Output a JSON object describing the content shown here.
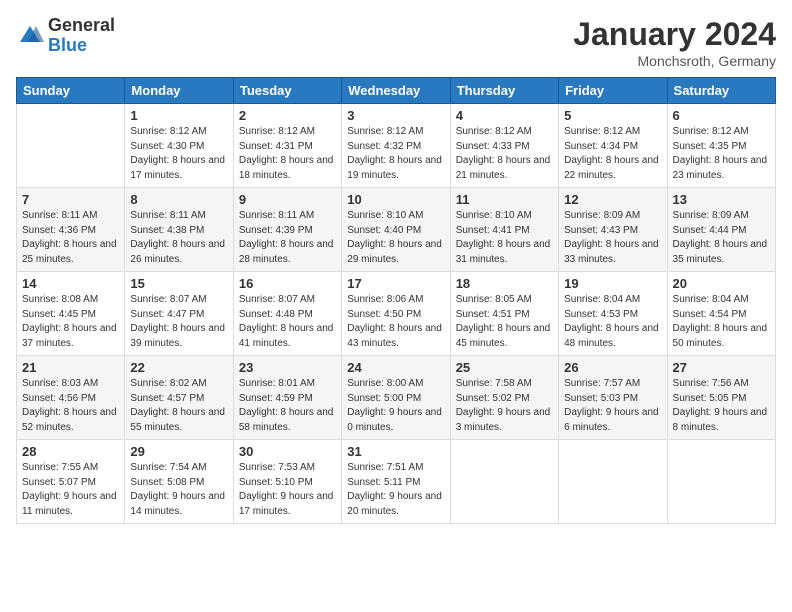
{
  "header": {
    "logo_general": "General",
    "logo_blue": "Blue",
    "title": "January 2024",
    "location": "Monchsroth, Germany"
  },
  "weekdays": [
    "Sunday",
    "Monday",
    "Tuesday",
    "Wednesday",
    "Thursday",
    "Friday",
    "Saturday"
  ],
  "weeks": [
    [
      {
        "day": "",
        "sunrise": "",
        "sunset": "",
        "daylight": ""
      },
      {
        "day": "1",
        "sunrise": "Sunrise: 8:12 AM",
        "sunset": "Sunset: 4:30 PM",
        "daylight": "Daylight: 8 hours and 17 minutes."
      },
      {
        "day": "2",
        "sunrise": "Sunrise: 8:12 AM",
        "sunset": "Sunset: 4:31 PM",
        "daylight": "Daylight: 8 hours and 18 minutes."
      },
      {
        "day": "3",
        "sunrise": "Sunrise: 8:12 AM",
        "sunset": "Sunset: 4:32 PM",
        "daylight": "Daylight: 8 hours and 19 minutes."
      },
      {
        "day": "4",
        "sunrise": "Sunrise: 8:12 AM",
        "sunset": "Sunset: 4:33 PM",
        "daylight": "Daylight: 8 hours and 21 minutes."
      },
      {
        "day": "5",
        "sunrise": "Sunrise: 8:12 AM",
        "sunset": "Sunset: 4:34 PM",
        "daylight": "Daylight: 8 hours and 22 minutes."
      },
      {
        "day": "6",
        "sunrise": "Sunrise: 8:12 AM",
        "sunset": "Sunset: 4:35 PM",
        "daylight": "Daylight: 8 hours and 23 minutes."
      }
    ],
    [
      {
        "day": "7",
        "sunrise": "Sunrise: 8:11 AM",
        "sunset": "Sunset: 4:36 PM",
        "daylight": "Daylight: 8 hours and 25 minutes."
      },
      {
        "day": "8",
        "sunrise": "Sunrise: 8:11 AM",
        "sunset": "Sunset: 4:38 PM",
        "daylight": "Daylight: 8 hours and 26 minutes."
      },
      {
        "day": "9",
        "sunrise": "Sunrise: 8:11 AM",
        "sunset": "Sunset: 4:39 PM",
        "daylight": "Daylight: 8 hours and 28 minutes."
      },
      {
        "day": "10",
        "sunrise": "Sunrise: 8:10 AM",
        "sunset": "Sunset: 4:40 PM",
        "daylight": "Daylight: 8 hours and 29 minutes."
      },
      {
        "day": "11",
        "sunrise": "Sunrise: 8:10 AM",
        "sunset": "Sunset: 4:41 PM",
        "daylight": "Daylight: 8 hours and 31 minutes."
      },
      {
        "day": "12",
        "sunrise": "Sunrise: 8:09 AM",
        "sunset": "Sunset: 4:43 PM",
        "daylight": "Daylight: 8 hours and 33 minutes."
      },
      {
        "day": "13",
        "sunrise": "Sunrise: 8:09 AM",
        "sunset": "Sunset: 4:44 PM",
        "daylight": "Daylight: 8 hours and 35 minutes."
      }
    ],
    [
      {
        "day": "14",
        "sunrise": "Sunrise: 8:08 AM",
        "sunset": "Sunset: 4:45 PM",
        "daylight": "Daylight: 8 hours and 37 minutes."
      },
      {
        "day": "15",
        "sunrise": "Sunrise: 8:07 AM",
        "sunset": "Sunset: 4:47 PM",
        "daylight": "Daylight: 8 hours and 39 minutes."
      },
      {
        "day": "16",
        "sunrise": "Sunrise: 8:07 AM",
        "sunset": "Sunset: 4:48 PM",
        "daylight": "Daylight: 8 hours and 41 minutes."
      },
      {
        "day": "17",
        "sunrise": "Sunrise: 8:06 AM",
        "sunset": "Sunset: 4:50 PM",
        "daylight": "Daylight: 8 hours and 43 minutes."
      },
      {
        "day": "18",
        "sunrise": "Sunrise: 8:05 AM",
        "sunset": "Sunset: 4:51 PM",
        "daylight": "Daylight: 8 hours and 45 minutes."
      },
      {
        "day": "19",
        "sunrise": "Sunrise: 8:04 AM",
        "sunset": "Sunset: 4:53 PM",
        "daylight": "Daylight: 8 hours and 48 minutes."
      },
      {
        "day": "20",
        "sunrise": "Sunrise: 8:04 AM",
        "sunset": "Sunset: 4:54 PM",
        "daylight": "Daylight: 8 hours and 50 minutes."
      }
    ],
    [
      {
        "day": "21",
        "sunrise": "Sunrise: 8:03 AM",
        "sunset": "Sunset: 4:56 PM",
        "daylight": "Daylight: 8 hours and 52 minutes."
      },
      {
        "day": "22",
        "sunrise": "Sunrise: 8:02 AM",
        "sunset": "Sunset: 4:57 PM",
        "daylight": "Daylight: 8 hours and 55 minutes."
      },
      {
        "day": "23",
        "sunrise": "Sunrise: 8:01 AM",
        "sunset": "Sunset: 4:59 PM",
        "daylight": "Daylight: 8 hours and 58 minutes."
      },
      {
        "day": "24",
        "sunrise": "Sunrise: 8:00 AM",
        "sunset": "Sunset: 5:00 PM",
        "daylight": "Daylight: 9 hours and 0 minutes."
      },
      {
        "day": "25",
        "sunrise": "Sunrise: 7:58 AM",
        "sunset": "Sunset: 5:02 PM",
        "daylight": "Daylight: 9 hours and 3 minutes."
      },
      {
        "day": "26",
        "sunrise": "Sunrise: 7:57 AM",
        "sunset": "Sunset: 5:03 PM",
        "daylight": "Daylight: 9 hours and 6 minutes."
      },
      {
        "day": "27",
        "sunrise": "Sunrise: 7:56 AM",
        "sunset": "Sunset: 5:05 PM",
        "daylight": "Daylight: 9 hours and 8 minutes."
      }
    ],
    [
      {
        "day": "28",
        "sunrise": "Sunrise: 7:55 AM",
        "sunset": "Sunset: 5:07 PM",
        "daylight": "Daylight: 9 hours and 11 minutes."
      },
      {
        "day": "29",
        "sunrise": "Sunrise: 7:54 AM",
        "sunset": "Sunset: 5:08 PM",
        "daylight": "Daylight: 9 hours and 14 minutes."
      },
      {
        "day": "30",
        "sunrise": "Sunrise: 7:53 AM",
        "sunset": "Sunset: 5:10 PM",
        "daylight": "Daylight: 9 hours and 17 minutes."
      },
      {
        "day": "31",
        "sunrise": "Sunrise: 7:51 AM",
        "sunset": "Sunset: 5:11 PM",
        "daylight": "Daylight: 9 hours and 20 minutes."
      },
      {
        "day": "",
        "sunrise": "",
        "sunset": "",
        "daylight": ""
      },
      {
        "day": "",
        "sunrise": "",
        "sunset": "",
        "daylight": ""
      },
      {
        "day": "",
        "sunrise": "",
        "sunset": "",
        "daylight": ""
      }
    ]
  ]
}
